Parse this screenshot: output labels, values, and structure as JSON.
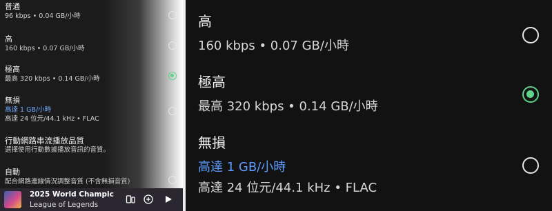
{
  "left_panel": {
    "options": [
      {
        "title": "普通",
        "subtitle": "96 kbps • 0.04 GB/小時",
        "selected": false
      },
      {
        "title": "高",
        "subtitle": "160 kbps • 0.07 GB/小時",
        "selected": false
      },
      {
        "title": "極高",
        "subtitle": "最高 320 kbps • 0.14 GB/小時",
        "selected": true
      },
      {
        "title": "無損",
        "subtitle_accent": "高達 1 GB/小時",
        "subtitle2": "高達 24 位元/44.1 kHz • FLAC",
        "selected": false
      }
    ],
    "section": {
      "title": "行動網路串流播放品質",
      "description": "選擇使用行動數據播放音訊的音質。"
    },
    "auto": {
      "title": "自動",
      "description": "配合網路連線情況調整音質 (不含無損音質)"
    }
  },
  "player": {
    "track_title": "2025 World Champic",
    "artist": "League of Legends",
    "icons": [
      "device-icon",
      "add-icon",
      "play-icon"
    ]
  },
  "right_panel": {
    "options": [
      {
        "title": "高",
        "subtitle": "160 kbps • 0.07 GB/小時",
        "selected": false
      },
      {
        "title": "極高",
        "subtitle": "最高 320 kbps • 0.14 GB/小時",
        "selected": true
      },
      {
        "title": "無損",
        "subtitle_accent": "高達 1 GB/小時",
        "subtitle2": "高達 24 位元/44.1 kHz • FLAC",
        "selected": false
      }
    ]
  },
  "colors": {
    "accent_green": "#5fd38a",
    "accent_blue": "#5c9bff",
    "background": "#121212"
  }
}
